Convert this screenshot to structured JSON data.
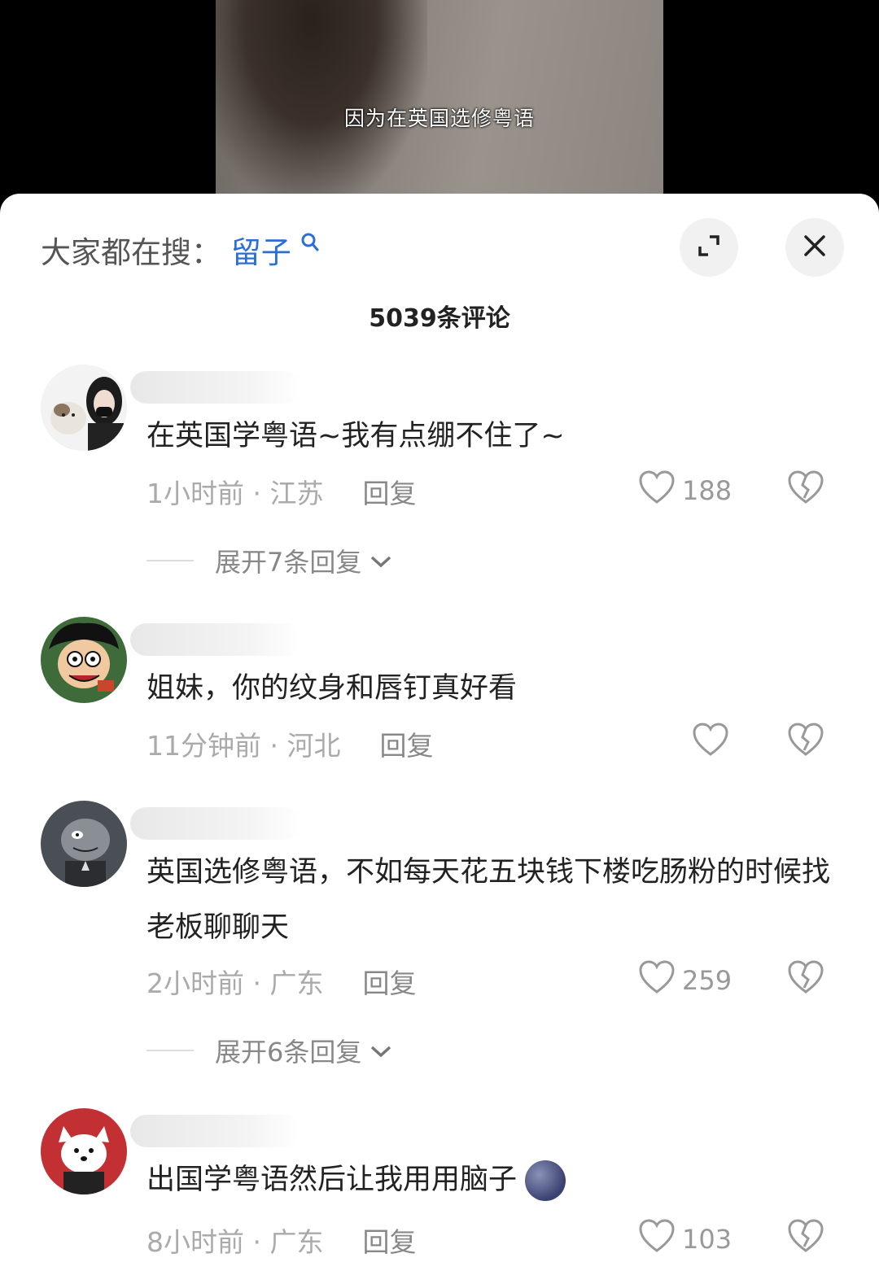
{
  "video": {
    "subtitle": "因为在英国选修粤语"
  },
  "sheet": {
    "search_label": "大家都在搜：",
    "search_keyword": "留子",
    "comment_count": "5039条评论"
  },
  "comments": [
    {
      "text": "在英国学粤语~我有点绷不住了~",
      "time_location": "1小时前 · 江苏",
      "reply_label": "回复",
      "likes": "188",
      "expand_label": "展开7条回复"
    },
    {
      "text": "姐妹，你的纹身和唇钉真好看",
      "time_location": "11分钟前 · 河北",
      "reply_label": "回复",
      "likes": ""
    },
    {
      "text": "英国选修粤语，不如每天花五块钱下楼吃肠粉的时候找老板聊聊天",
      "time_location": "2小时前 · 广东",
      "reply_label": "回复",
      "likes": "259",
      "expand_label": "展开6条回复"
    },
    {
      "text": "出国学粤语然后让我用用脑子",
      "time_location": "8小时前 · 广东",
      "reply_label": "回复",
      "likes": "103"
    }
  ],
  "icons": {
    "expand": "expand-icon",
    "close": "close-icon",
    "like": "heart-icon",
    "dislike": "broken-heart-icon",
    "chevron": "chevron-down-icon",
    "search": "search-icon"
  },
  "colors": {
    "keyword": "#2b6fd6",
    "meta": "#aaaaaa"
  }
}
